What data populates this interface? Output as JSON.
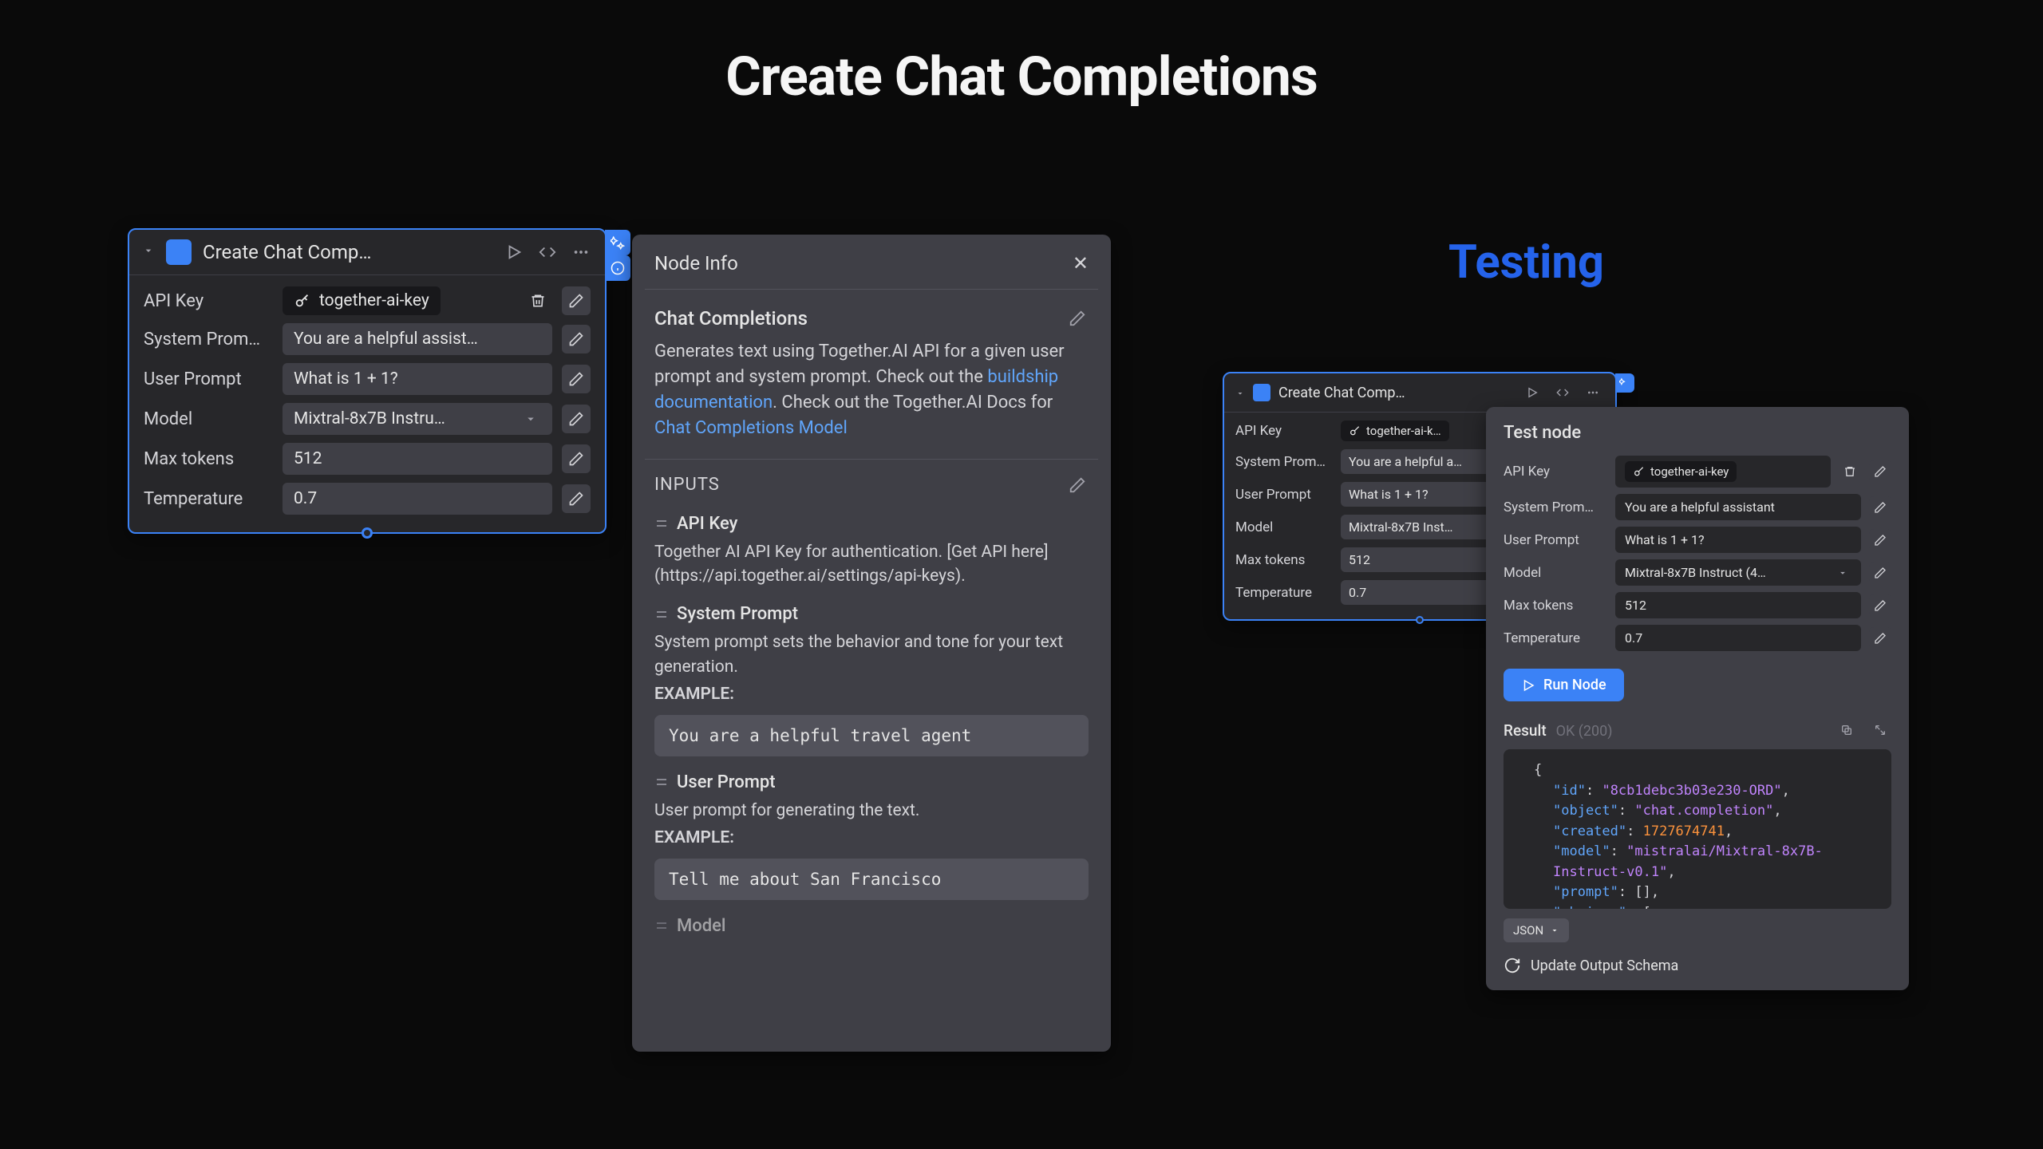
{
  "heading": "Create Chat Completions",
  "testing_label": "Testing",
  "node": {
    "title": "Create Chat Comp…",
    "fields": {
      "apiKey": {
        "label": "API Key",
        "value": "together-ai-key"
      },
      "systemPrompt": {
        "label": "System Prom…",
        "value": "You are a helpful assist…"
      },
      "userPrompt": {
        "label": "User Prompt",
        "value": "What is 1 + 1?"
      },
      "model": {
        "label": "Model",
        "value": "Mixtral-8x7B Instru…"
      },
      "maxTokens": {
        "label": "Max tokens",
        "value": "512"
      },
      "temperature": {
        "label": "Temperature",
        "value": "0.7"
      }
    }
  },
  "info": {
    "header": "Node Info",
    "subhead": "Chat Completions",
    "desc1": "Generates text using Together.AI API for a given user prompt and system prompt. Check out the ",
    "link1": "buildship documentation",
    "desc2": ". Check out the Together.AI Docs for ",
    "link2": "Chat Completions Model",
    "inputsTitle": "INPUTS",
    "inputs": [
      {
        "name": "API Key",
        "desc": "Together AI API Key for authentication. [Get API here] (https://api.together.ai/settings/api-keys)."
      },
      {
        "name": "System Prompt",
        "desc": "System prompt sets the behavior and tone for your text generation.",
        "exampleLabel": "EXAMPLE:",
        "example": "You are a helpful travel agent"
      },
      {
        "name": "User Prompt",
        "desc": "User prompt for generating the text.",
        "exampleLabel": "EXAMPLE:",
        "example": "Tell me about San Francisco"
      },
      {
        "name": "Model"
      }
    ]
  },
  "test": {
    "title": "Test node",
    "fields": {
      "apiKey": {
        "label": "API Key",
        "value": "together-ai-key"
      },
      "systemPrompt": {
        "label": "System Prom…",
        "value": "You are a helpful assistant"
      },
      "userPrompt": {
        "label": "User Prompt",
        "value": "What is 1 + 1?"
      },
      "model": {
        "label": "Model",
        "value": "Mixtral-8x7B Instruct (4…"
      },
      "maxTokens": {
        "label": "Max tokens",
        "value": "512"
      },
      "temperature": {
        "label": "Temperature",
        "value": "0.7"
      }
    },
    "runBtn": "Run Node",
    "resultLabel": "Result",
    "resultStatus": "OK (200)",
    "formatSelector": "JSON",
    "updateSchema": "Update Output Schema",
    "output": {
      "id": "8cb1debc3b03e230-ORD",
      "object": "chat.completion",
      "created": 1727674741,
      "model": "mistralai/Mixtral-8x7B-Instruct-v0.1",
      "prompt": "[]",
      "choices_open": "["
    }
  },
  "smallNode": {
    "title": "Create Chat Comp…",
    "fields": {
      "apiKey": {
        "label": "API Key",
        "value": "together-ai-k…"
      },
      "systemPrompt": {
        "label": "System Prom…",
        "value": "You are a helpful a…"
      },
      "userPrompt": {
        "label": "User Prompt",
        "value": "What is 1 + 1?"
      },
      "model": {
        "label": "Model",
        "value": "Mixtral-8x7B Inst…"
      },
      "maxTokens": {
        "label": "Max tokens",
        "value": "512"
      },
      "temperature": {
        "label": "Temperature",
        "value": "0.7"
      }
    }
  }
}
